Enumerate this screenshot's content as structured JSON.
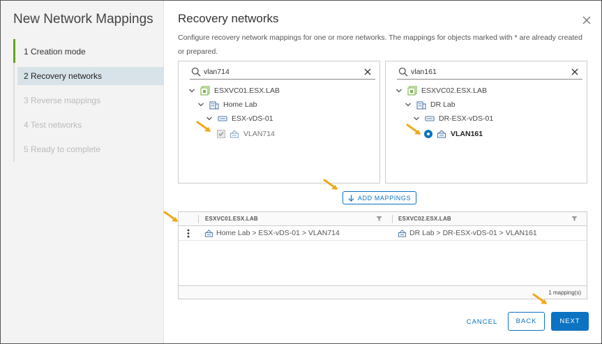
{
  "sidebar": {
    "title": "New Network Mappings",
    "steps": [
      {
        "label": "1  Creation mode",
        "state": "done"
      },
      {
        "label": "2  Recovery networks",
        "state": "active"
      },
      {
        "label": "3  Reverse mappings",
        "state": "disabled"
      },
      {
        "label": "4  Test networks",
        "state": "disabled"
      },
      {
        "label": "5  Ready to complete",
        "state": "disabled"
      }
    ]
  },
  "main": {
    "title": "Recovery networks",
    "description": "Configure recovery network mappings for one or more networks. The mappings for objects marked with * are already created or prepared."
  },
  "left_panel": {
    "search_value": "vlan714",
    "tree": {
      "vcenter": "ESXVC01.ESX.LAB",
      "datacenter": "Home Lab",
      "switch": "ESX-vDS-01",
      "network": "VLAN714"
    }
  },
  "right_panel": {
    "search_value": "vlan161",
    "tree": {
      "vcenter": "ESXVC02.ESX.LAB",
      "datacenter": "DR Lab",
      "switch": "DR-ESX-vDS-01",
      "network": "VLAN161"
    }
  },
  "add_mappings_label": "ADD MAPPINGS",
  "grid": {
    "columns": [
      "ESXVC01.ESX.LAB",
      "ESXVC02.ESX.LAB"
    ],
    "rows": [
      {
        "source": "Home Lab > ESX-vDS-01 > VLAN714",
        "target": "DR Lab > DR-ESX-vDS-01 > VLAN161"
      }
    ],
    "footer": "1 mapping(s)"
  },
  "buttons": {
    "cancel": "CANCEL",
    "back": "BACK",
    "next": "NEXT"
  },
  "colors": {
    "accent": "#0b73c2",
    "active_step_bar": "#62a420",
    "annotation_arrow": "#f0a81c",
    "active_step_bg": "#d8e3e9"
  },
  "icons": {
    "vcenter": "vcenter-icon",
    "datacenter": "datacenter-icon",
    "switch": "distributed-switch-icon",
    "network": "port-group-icon"
  }
}
